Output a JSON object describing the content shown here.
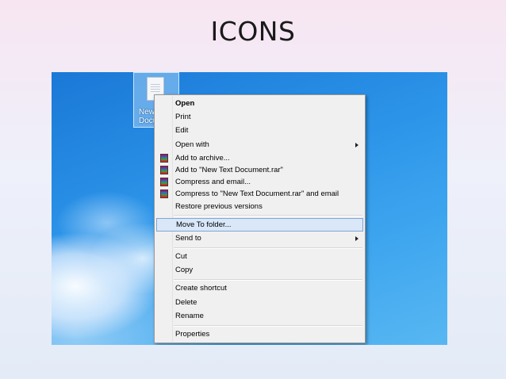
{
  "slide": {
    "title": "ICONS"
  },
  "desktop": {
    "icon_label_line1": "New",
    "icon_label_line2": "Docu",
    "icon_name": "text-document-icon"
  },
  "context_menu": {
    "open": "Open",
    "print": "Print",
    "edit": "Edit",
    "open_with": "Open with",
    "add_to_archive": "Add to archive...",
    "add_to_rar": "Add to \"New Text Document.rar\"",
    "compress_email": "Compress and email...",
    "compress_rar_email": "Compress to \"New Text Document.rar\" and email",
    "restore_versions": "Restore previous versions",
    "move_to_folder": "Move To folder...",
    "send_to": "Send to",
    "cut": "Cut",
    "copy": "Copy",
    "create_shortcut": "Create shortcut",
    "delete": "Delete",
    "rename": "Rename",
    "properties": "Properties"
  },
  "colors": {
    "desktop_blue": "#2b93e8",
    "menu_bg": "#f0f0f0",
    "highlight_bg": "#d9e7f8",
    "highlight_border": "#7ea6d6"
  }
}
